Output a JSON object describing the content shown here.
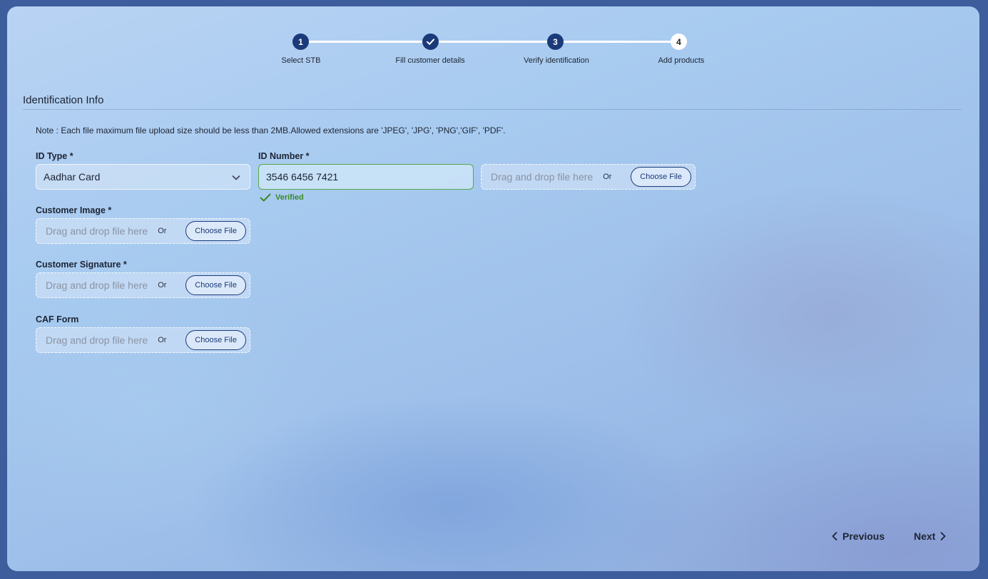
{
  "stepper": {
    "steps": [
      {
        "label": "Select STB",
        "marker": "1",
        "state": "active"
      },
      {
        "label": "Fill customer details",
        "marker": "check",
        "state": "completed"
      },
      {
        "label": "Verify identification",
        "marker": "3",
        "state": "active"
      },
      {
        "label": "Add products",
        "marker": "4",
        "state": "pending"
      }
    ]
  },
  "section": {
    "title": "Identification Info"
  },
  "note": "Note : Each file maximum file upload size should be less than 2MB.Allowed extensions are 'JPEG', 'JPG', 'PNG','GIF', 'PDF'.",
  "id_type": {
    "label": "ID Type *",
    "value": "Aadhar Card",
    "icon": "chevron-down-icon"
  },
  "id_number": {
    "label": "ID Number *",
    "value": "3546 6456 7421",
    "status": "Verified",
    "status_icon": "check-icon"
  },
  "id_upload": {
    "hint": "Drag and drop file here",
    "or": "Or",
    "button": "Choose File"
  },
  "customer_image": {
    "label": "Customer Image *",
    "hint": "Drag and drop file here",
    "or": "Or",
    "button": "Choose File"
  },
  "customer_signature": {
    "label": "Customer Signature *",
    "hint": "Drag and drop file here",
    "or": "Or",
    "button": "Choose File"
  },
  "caf_form": {
    "label": "CAF Form",
    "hint": "Drag and drop file here",
    "or": "Or",
    "button": "Choose File"
  },
  "nav": {
    "previous": "Previous",
    "next": "Next"
  },
  "colors": {
    "primary": "#1b3a7a",
    "success": "#3d8a2a",
    "verified_border": "#5aa84a"
  }
}
